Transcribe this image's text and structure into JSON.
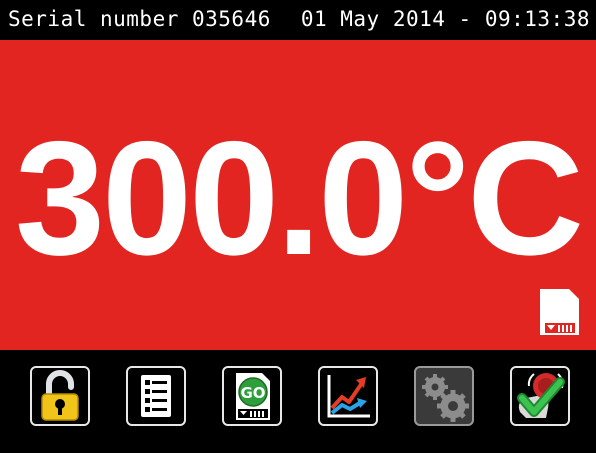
{
  "status_bar": {
    "serial": "Serial number 035646",
    "datetime": "01 May 2014 - 09:13:38"
  },
  "display": {
    "temperature": "300.0°C",
    "background_color": "#e32522"
  },
  "toolbar": {
    "buttons": [
      {
        "icon": "unlock-icon",
        "enabled": true
      },
      {
        "icon": "list-icon",
        "enabled": true
      },
      {
        "icon": "go-sd-card-icon",
        "label": "GO",
        "enabled": true
      },
      {
        "icon": "graph-icon",
        "enabled": true
      },
      {
        "icon": "settings-gears-icon",
        "enabled": false
      },
      {
        "icon": "alarm-acknowledge-icon",
        "enabled": true
      }
    ]
  }
}
